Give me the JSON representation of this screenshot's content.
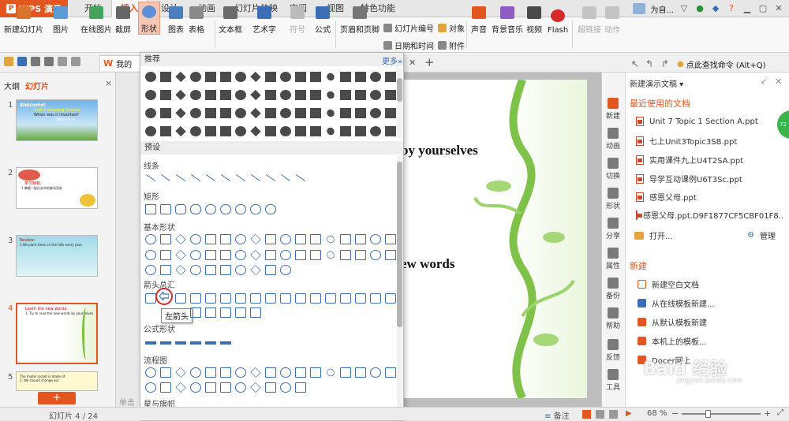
{
  "app": {
    "name": "WPS 演示",
    "logo_letter": "P"
  },
  "menu_tabs": [
    "开始",
    "插入",
    "设计",
    "动画",
    "幻灯片放映",
    "审阅",
    "视图",
    "特色功能"
  ],
  "active_tab": "插入",
  "topright": {
    "user": "为自...",
    "restore": "▽"
  },
  "ribbon": {
    "new_slide": "新建幻灯片",
    "picture": "图片",
    "online_picture": "在线图片",
    "screenshot": "截屏",
    "shapes": "形状",
    "chart": "图表",
    "table": "表格",
    "textbox": "文本框",
    "wordart": "艺术字",
    "symbol": "符号",
    "formula": "公式",
    "header_footer": "页眉和页脚",
    "slide_number": "幻灯片编号",
    "object": "对象",
    "datetime": "日期和时间",
    "attachment": "附件",
    "sound": "声音",
    "bg_music": "背景音乐",
    "video": "视频",
    "flash": "Flash",
    "hyperlink": "超链接",
    "action": "动作"
  },
  "tabbar": {
    "doc_label": "我的",
    "new_tab": "+",
    "search_cmd": "点此查找命令 (Alt+Q)"
  },
  "left_panel": {
    "tab_outline": "大纲",
    "tab_slides": "幻灯片",
    "close": "×",
    "add": "+",
    "slides": [
      {
        "num": "1",
        "title": "Unit 4 Amazing Science",
        "sub": "When was it invented?",
        "extra": "Section A"
      },
      {
        "num": "2",
        "title": "学习目标:",
        "sub": "1.掌握一般过去时的被动语态"
      },
      {
        "num": "3",
        "title": "Review:",
        "sub": "1.We plant trees on the hills every year."
      },
      {
        "num": "4",
        "title": "Learn the new words:",
        "sub": "1. Try to read the new words by yourselves"
      },
      {
        "num": "5",
        "title": "The model rocket is made of",
        "sub": "2. We should change our"
      }
    ]
  },
  "popup": {
    "recommended": "推荐",
    "more": "更多»",
    "presets": "预设",
    "sections": [
      "线条",
      "矩形",
      "基本形状",
      "箭头总汇",
      "公式形状",
      "流程图",
      "星与旗帜"
    ],
    "tooltip": "左箭头"
  },
  "slide": {
    "line1": "by yourselves",
    "line2": "ew words",
    "note_placeholder": "单击"
  },
  "task_strip": [
    "新建",
    "动画",
    "切换",
    "形状",
    "分享",
    "属性",
    "备份",
    "帮助",
    "反馈",
    "工具"
  ],
  "task_pane": {
    "title": "新建演示文稿",
    "recent_header": "最近使用的文档",
    "recent": [
      "Unit 7 Topic 1 Section A.ppt",
      "七上Unit3Topic3SB.ppt",
      "实用课件九上U4T2SA.ppt",
      "导学互动课例U6T3Sc.ppt",
      "感恩父母.ppt",
      "感恩父母.ppt.D9F1877CF5CBF01F8..."
    ],
    "open": "打开...",
    "manage": "管理",
    "new_header": "新建",
    "new_items": [
      "新建空白文档",
      "从在线模板新建...",
      "从默认模板新建",
      "本机上的模板...",
      "Docer网上",
      ""
    ]
  },
  "status": {
    "slide_info": "幻灯片 4 / 24",
    "notes": "备注",
    "zoom": "68 %"
  },
  "watermark": {
    "text": "Baid 经验",
    "url": "jingyan.baidu.com"
  },
  "colors": {
    "accent": "#e4561f",
    "shape_blue": "#3b6fb5"
  }
}
